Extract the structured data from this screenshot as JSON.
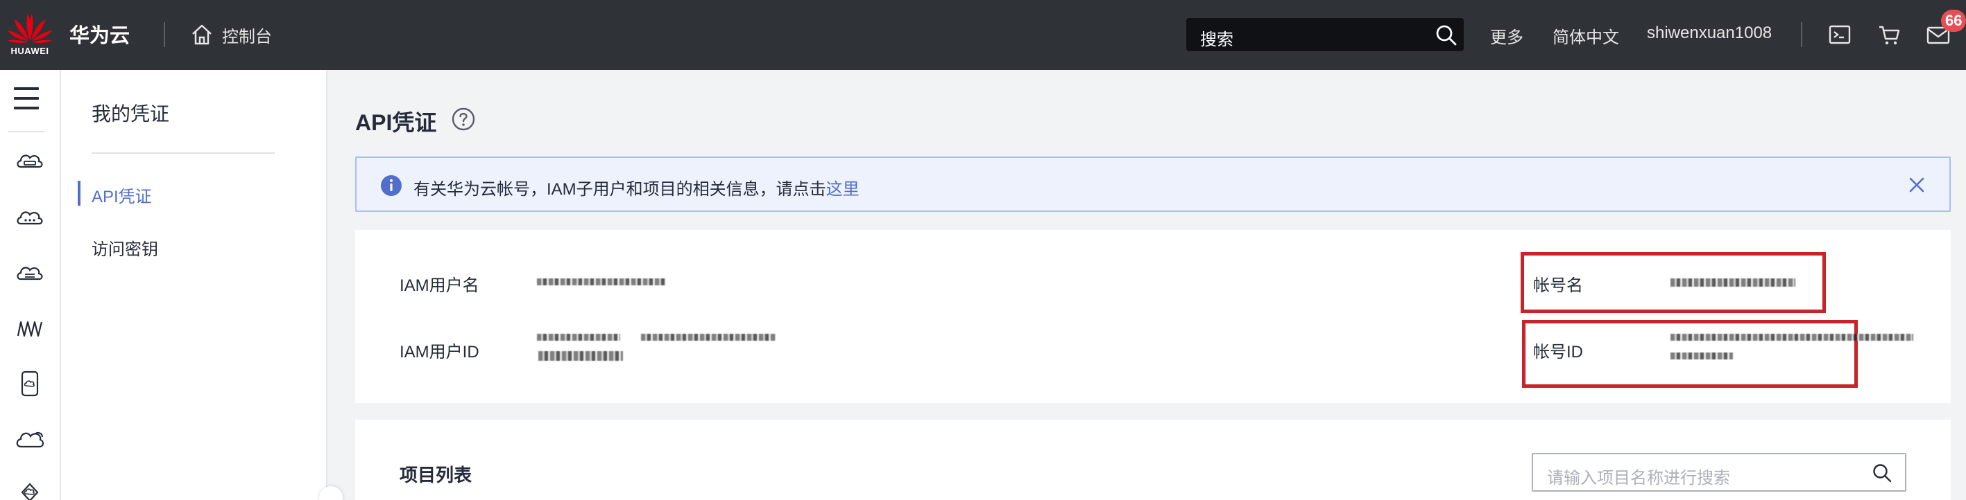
{
  "topbar": {
    "logo_text": "HUAWEI",
    "brand": "华为云",
    "console_label": "控制台",
    "search_placeholder": "搜索",
    "more": "更多",
    "language": "简体中文",
    "username": "shiwenxuan1008",
    "messages_badge": "66"
  },
  "sidenav": {
    "title": "我的凭证",
    "items": [
      {
        "label": "API凭证",
        "active": true
      },
      {
        "label": "访问密钥",
        "active": false
      }
    ]
  },
  "main": {
    "title": "API凭证",
    "notice": {
      "text": "有关华为云帐号，IAM子用户和项目的相关信息，请点击",
      "link": "这里"
    },
    "credentials": {
      "iam_user_name_label": "IAM用户名",
      "iam_user_id_label": "IAM用户ID",
      "account_name_label": "帐号名",
      "account_id_label": "帐号ID"
    },
    "projects": {
      "title": "项目列表",
      "search_placeholder": "请输入项目名称进行搜索"
    }
  },
  "colors": {
    "topbar_bg": "#2f3337",
    "accent": "#526ecc",
    "highlight_box": "#c8222a",
    "notice_bg": "#eef2fd",
    "badge": "#e84f55"
  },
  "icons": [
    "huawei-logo",
    "home-icon",
    "search-icon",
    "terminal-icon",
    "cart-icon",
    "mail-icon",
    "menu-icon",
    "help-icon",
    "info-icon",
    "close-icon"
  ]
}
